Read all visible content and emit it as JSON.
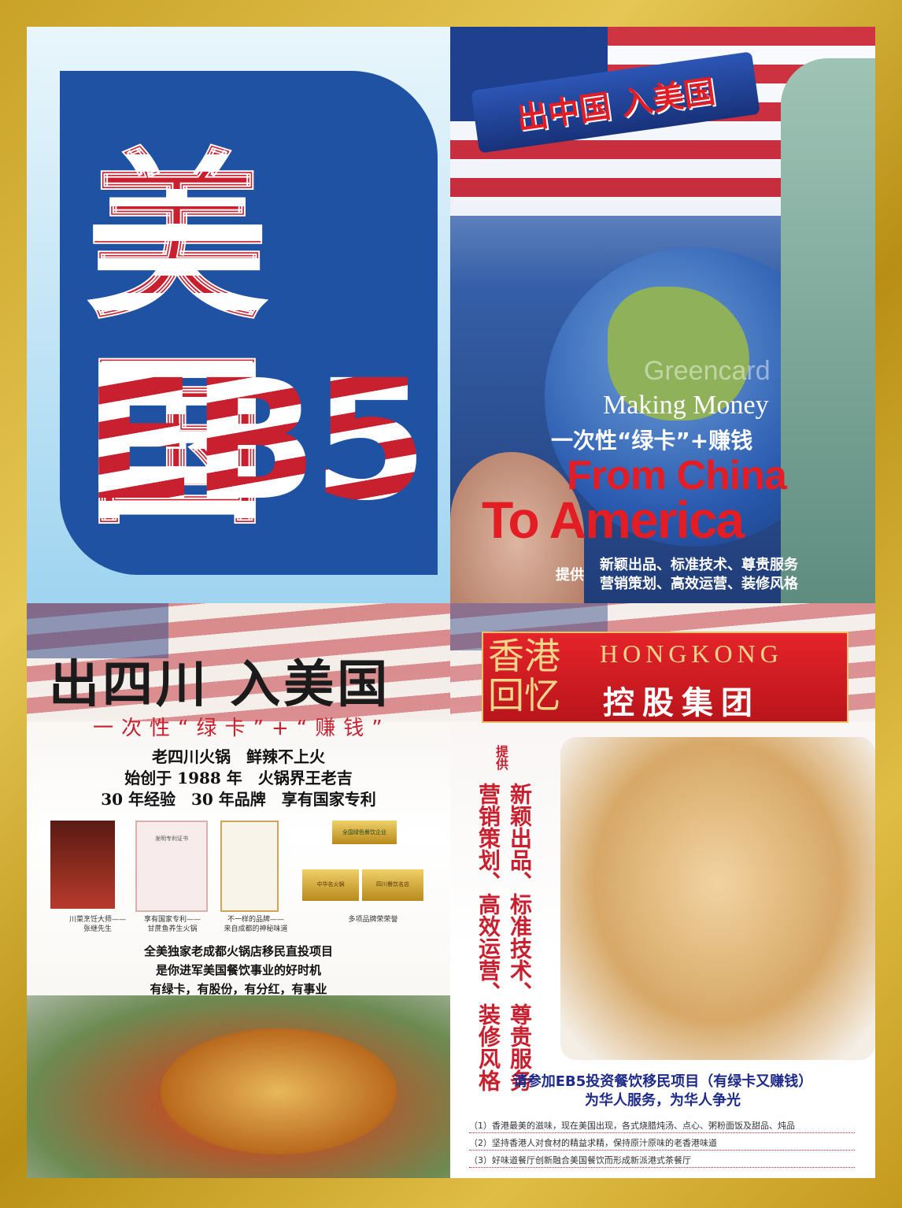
{
  "panel1": {
    "big_char": "美国",
    "eb5": "EB5"
  },
  "panel2": {
    "banner": "出中国 入美国",
    "greencard": "Greencard",
    "making_money": "Making Money",
    "cn_line": "一次性“绿卡”+赚钱",
    "from_china": "From China",
    "to_america": "To America",
    "tigong": "提供",
    "services_1": "新颖出品、标准技术、尊贵服务",
    "services_2": "营销策划、高效运营、装修风格"
  },
  "panel3": {
    "title": "出四川 入美国",
    "subtitle": "一次性“绿卡”+“赚钱”",
    "line1": "老四川火锅　鲜辣不上火",
    "line2": "始创于 1988 年　火锅界王老吉",
    "line3": "30 年经验　30 年品牌　享有国家专利",
    "cap1a": "川菜烹饪大师——",
    "cap1b": "张继先生",
    "cap2a": "享有国家专利——",
    "cap2b": "甘蔗鱼养生火锅",
    "cap3a": "不一样的品牌——",
    "cap3b": "来自成都的神秘味道",
    "cap4": "多项品牌荣荣誉",
    "cert_label": "发明专利证书",
    "badge_label": "全国绿色餐饮企业",
    "plaque_label": "中华名火锅",
    "plaque_label_2": "四川餐饮名店",
    "m1": "全美独家老成都火锅店移民直投项目",
    "m2": "是你进军美国餐饮事业的好时机",
    "m3": "有绿卡，有股份，有分红，有事业"
  },
  "panel4": {
    "hk_cn_1": "香港",
    "hk_cn_2": "回忆",
    "hk_en": "HONGKONG",
    "hk_group": "控股集团",
    "tigong": "提供",
    "v1": "新颖出品、标准技术、尊贵服务",
    "v2": "营销策划、高效运营、装修风格",
    "cta1": "请参加EB5投资餐饮移民项目（有绿卡又赚钱）",
    "cta2": "为华人服务，为华人争光",
    "li1": "（1）香港最美的滋味，现在美国出现，各式烧腊炖汤、点心、粥粉面饭及甜品、炖品",
    "li2": "（2）坚持香港人对食材的精益求精，保持原汁原味的老香港味道",
    "li3": "（3）好味道餐厅创新融合美国餐饮而形成新派港式茶餐厅"
  }
}
